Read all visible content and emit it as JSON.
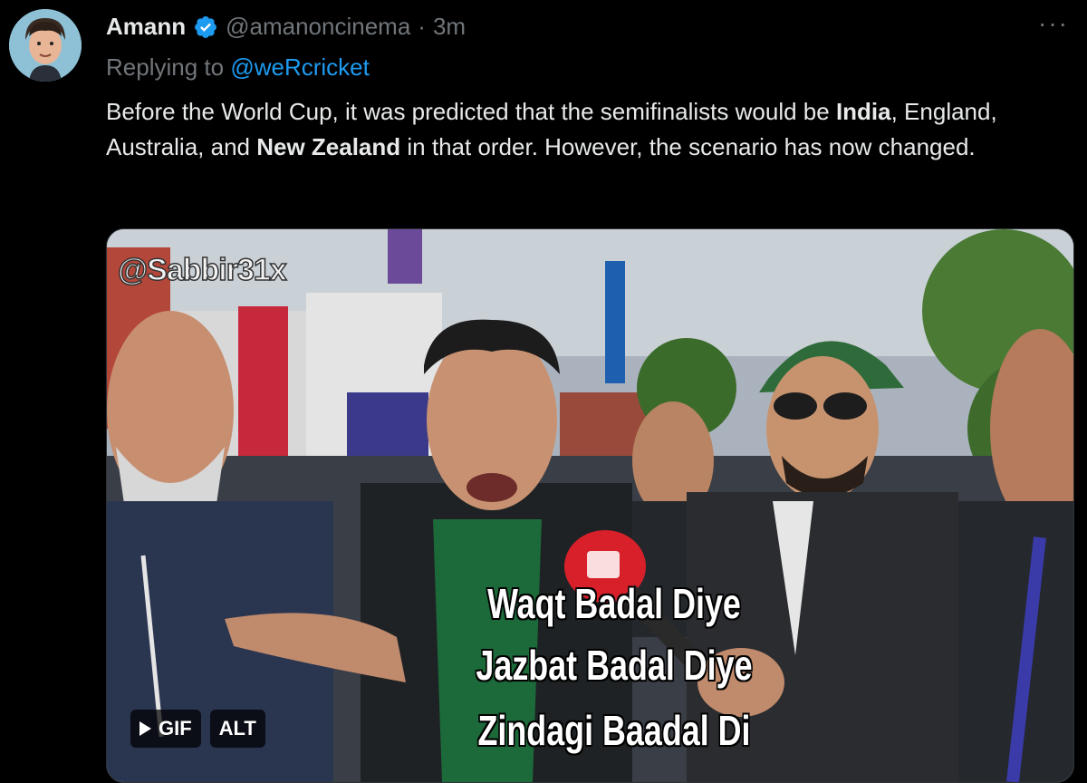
{
  "tweet": {
    "author_name": "Amann",
    "handle": "@amanoncinema",
    "separator": "·",
    "time": "3m",
    "more": "···",
    "replying_prefix": "Replying to",
    "replying_to": "@weRcricket",
    "text_part1": "Before the World Cup, it was predicted that the semifinalists would be ",
    "text_bold1": "India",
    "text_part2": ", England, Australia, and ",
    "text_bold2": "New Zealand",
    "text_part3": " in that order. However, the scenario has now changed."
  },
  "media": {
    "watermark": "@Sabbir31x",
    "caption_line1": "Waqt Badal Diye",
    "caption_line2": "Jazbat Badal Diye",
    "caption_line3": "Zindagi Baadal Di",
    "gif_badge": "GIF",
    "alt_badge": "ALT"
  },
  "colors": {
    "background": "#000000",
    "link": "#1d9bf0",
    "muted": "#71767b",
    "verified": "#1d9bf0"
  },
  "icons": {
    "verified": "verified-badge-icon",
    "play": "play-icon",
    "more": "more-icon"
  }
}
